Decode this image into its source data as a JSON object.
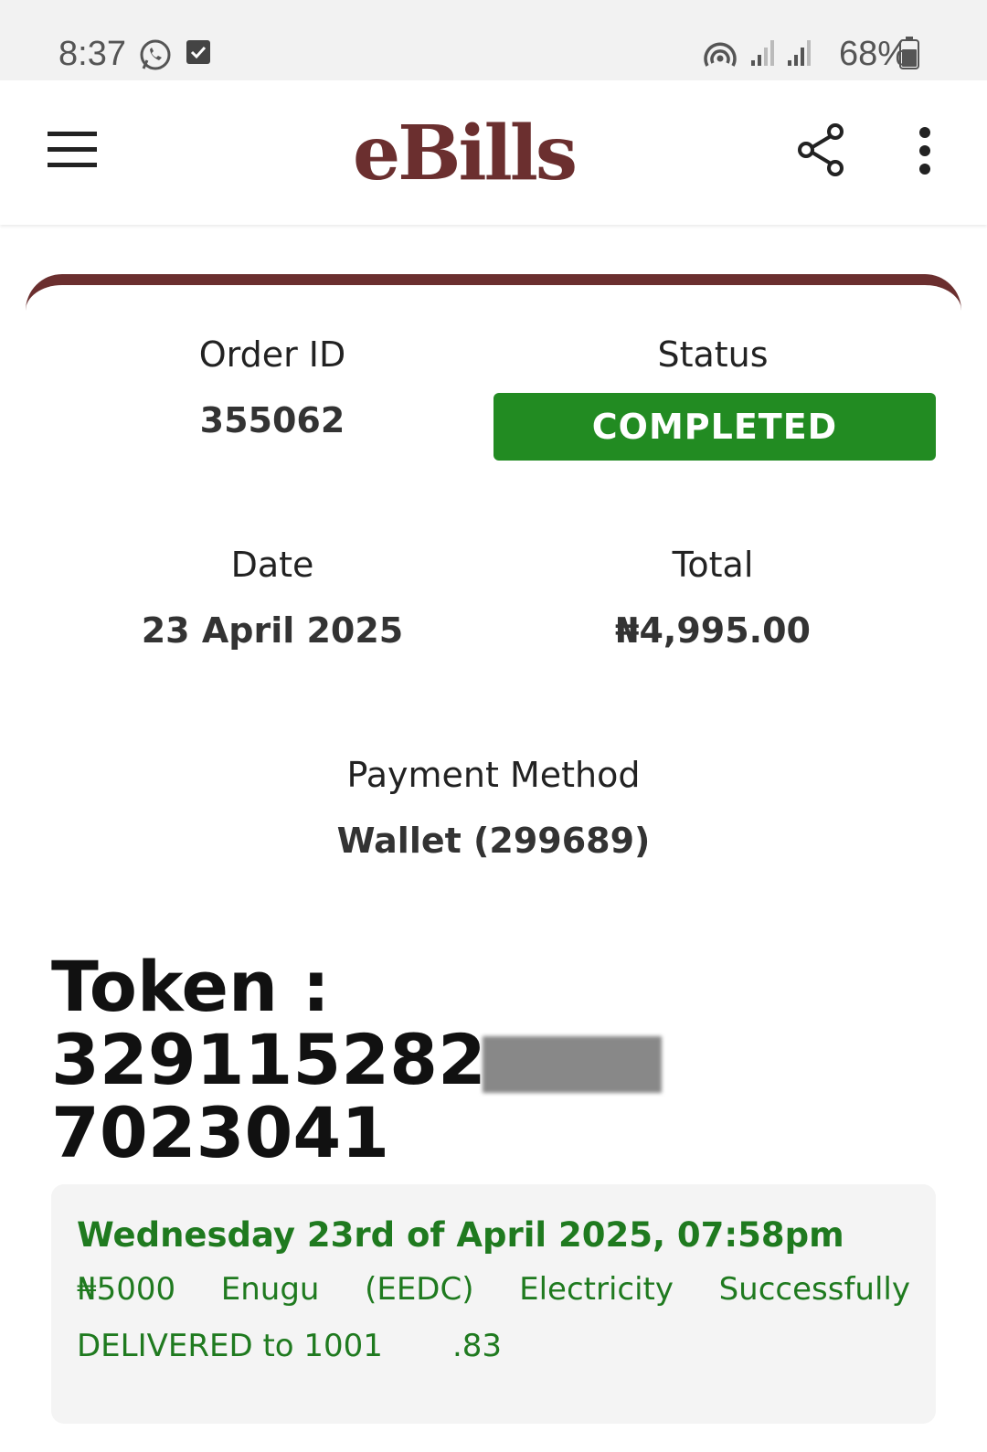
{
  "status_bar": {
    "time": "8:37",
    "battery": "68%"
  },
  "app": {
    "logo": "eBills"
  },
  "order": {
    "order_id_label": "Order ID",
    "order_id": "355062",
    "status_label": "Status",
    "status": "COMPLETED",
    "date_label": "Date",
    "date": "23 April 2025",
    "total_label": "Total",
    "total": "₦4,995.00",
    "payment_label": "Payment Method",
    "payment": "Wallet (299689)"
  },
  "token": {
    "label": "Token :",
    "prefix": "329115282",
    "suffix": "7023041"
  },
  "notice": {
    "datetime": "Wednesday 23rd of April 2025, 07:58pm",
    "words": [
      "₦5000",
      "Enugu",
      "(EEDC)",
      "Electricity",
      "Successfully"
    ],
    "line2_prefix": "DELIVERED to 1001",
    "line2_suffix": ".83"
  },
  "colors": {
    "brand": "#6b2f2f",
    "success": "#228b22",
    "notice_text": "#1f7a1f"
  }
}
